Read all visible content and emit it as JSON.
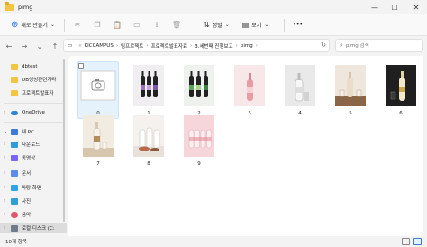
{
  "window": {
    "title": "pimg"
  },
  "command_bar": {
    "new_label": "새로 만들기",
    "sort_label": "정렬",
    "view_label": "보기",
    "more_label": "•••"
  },
  "address_bar": {
    "crumbs": [
      "KICCAMPUS",
      "팀프로젝트",
      "프로젝트발표자료",
      "3.세번째 진행보고",
      "pimg"
    ],
    "overflow": "«"
  },
  "search": {
    "placeholder": "pimg 검색"
  },
  "sidebar": {
    "items": [
      {
        "label": "dbtest",
        "icon": "folder"
      },
      {
        "label": "DB생성관련기타",
        "icon": "folder"
      },
      {
        "label": "프로젝트발표자",
        "icon": "folder"
      },
      {
        "label": "OneDrive",
        "icon": "cloud"
      },
      {
        "label": "내 PC",
        "icon": "pc"
      },
      {
        "label": "다운로드",
        "icon": "down"
      },
      {
        "label": "동영상",
        "icon": "video"
      },
      {
        "label": "문서",
        "icon": "doc"
      },
      {
        "label": "바탕 화면",
        "icon": "desk"
      },
      {
        "label": "사진",
        "icon": "pic"
      },
      {
        "label": "음악",
        "icon": "music"
      },
      {
        "label": "로컬 디스크 (C:",
        "icon": "drive"
      }
    ]
  },
  "files": [
    {
      "name": "0",
      "kind": "placeholder-image-icon",
      "selected": true
    },
    {
      "name": "1",
      "kind": "wine-bottles-purple"
    },
    {
      "name": "2",
      "kind": "wine-bottles-green"
    },
    {
      "name": "3",
      "kind": "pink-bottle"
    },
    {
      "name": "4",
      "kind": "clear-bottle-grey"
    },
    {
      "name": "5",
      "kind": "bottle-glasses-brown"
    },
    {
      "name": "6",
      "kind": "bottle-dark"
    },
    {
      "name": "7",
      "kind": "bottle-glass-beige"
    },
    {
      "name": "8",
      "kind": "dessert-bottles"
    },
    {
      "name": "9",
      "kind": "pink-bottles-row"
    }
  ],
  "status": {
    "count": "10개 항목"
  }
}
